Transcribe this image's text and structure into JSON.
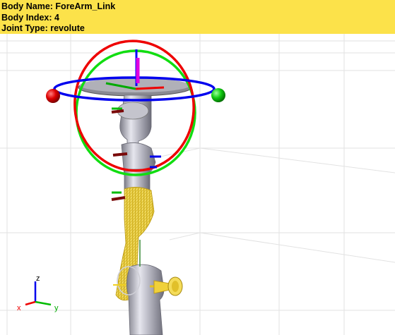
{
  "info": {
    "body_name_label": "Body Name:",
    "body_name": "ForeArm_Link",
    "body_index_label": "Body Index:",
    "body_index": "4",
    "joint_type_label": "Joint Type:",
    "joint_type": "revolute"
  },
  "axes_triad": {
    "x_label": "x",
    "y_label": "y",
    "z_label": "z"
  },
  "colors": {
    "info_panel_bg": "#fce24a",
    "selected_body": "#f5d63a",
    "robot_body": "#b9b9c3",
    "x_axis": "#ff0000",
    "y_axis": "#00cc00",
    "z_axis": "#0000ff",
    "joint_axis": "#e000e0",
    "frame_marker": "#7a0a0a"
  }
}
